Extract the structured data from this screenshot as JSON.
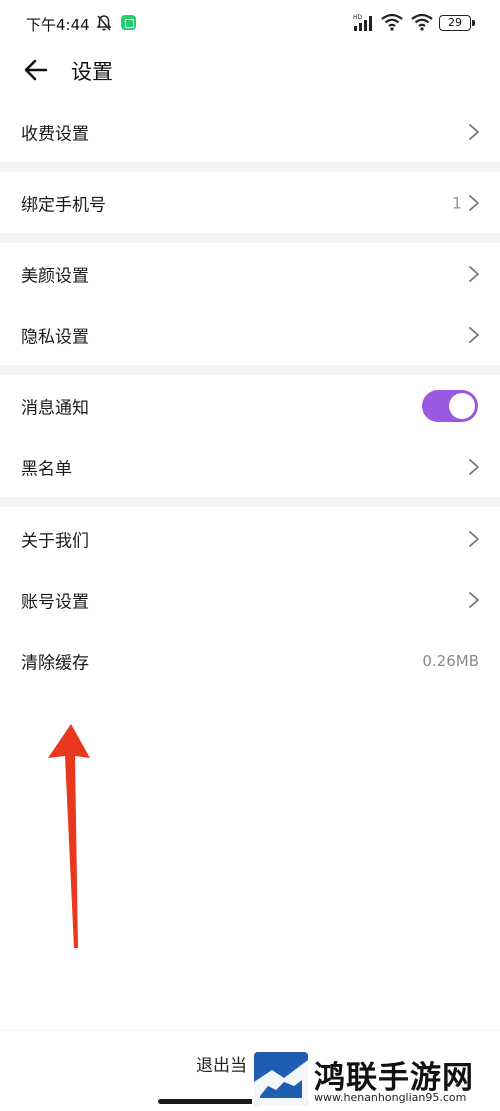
{
  "status_bar": {
    "time": "下午4:44",
    "battery": "29",
    "icons": [
      "bell-off-icon",
      "app-notification-icon",
      "hd-signal-icon",
      "wifi-icon",
      "wifi-icon",
      "battery-icon"
    ]
  },
  "header": {
    "title": "设置",
    "back_icon": "arrow-left-icon"
  },
  "settings": {
    "fee": "收费设置",
    "bind_phone": "绑定手机号",
    "bind_phone_value": "1",
    "beauty": "美颜设置",
    "privacy": "隐私设置",
    "notifications": "消息通知",
    "notifications_on": true,
    "blacklist": "黑名单",
    "about": "关于我们",
    "account": "账号设置",
    "clear_cache": "清除缓存",
    "cache_size": "0.26MB"
  },
  "footer": {
    "logout": "退出当"
  },
  "watermark": {
    "name": "鸿联手游网",
    "url": "www.henanhonglian95.com"
  },
  "colors": {
    "toggle_on": "#9b58e0",
    "annotation_arrow": "#e8391f",
    "section_gap": "#f4f4f4",
    "watermark_badge": "#1f5db3"
  }
}
